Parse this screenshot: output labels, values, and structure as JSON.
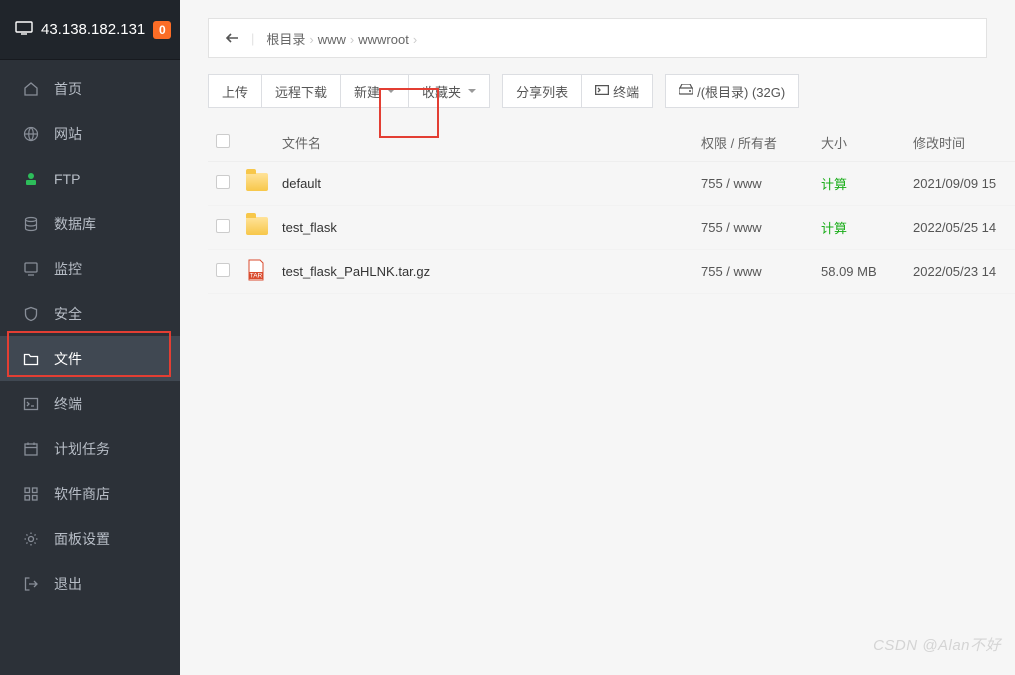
{
  "header": {
    "ip": "43.138.182.131",
    "badge": "0"
  },
  "sidebar": {
    "items": [
      {
        "label": "首页",
        "icon": "home-icon"
      },
      {
        "label": "网站",
        "icon": "globe-icon"
      },
      {
        "label": "FTP",
        "icon": "ftp-icon"
      },
      {
        "label": "数据库",
        "icon": "database-icon"
      },
      {
        "label": "监控",
        "icon": "monitor-icon"
      },
      {
        "label": "安全",
        "icon": "shield-icon"
      },
      {
        "label": "文件",
        "icon": "folder-icon"
      },
      {
        "label": "终端",
        "icon": "terminal-icon"
      },
      {
        "label": "计划任务",
        "icon": "calendar-icon"
      },
      {
        "label": "软件商店",
        "icon": "apps-icon"
      },
      {
        "label": "面板设置",
        "icon": "gear-icon"
      },
      {
        "label": "退出",
        "icon": "exit-icon"
      }
    ]
  },
  "breadcrumb": {
    "items": [
      "根目录",
      "www",
      "wwwroot"
    ]
  },
  "toolbar": {
    "upload": "上传",
    "remote_download": "远程下载",
    "create": "新建",
    "favorites": "收藏夹",
    "share_list": "分享列表",
    "terminal": "终端",
    "disk": "/(根目录) (32G)"
  },
  "columns": {
    "name": "文件名",
    "perm": "权限 / 所有者",
    "size": "大小",
    "mtime": "修改时间"
  },
  "files": [
    {
      "name": "default",
      "type": "folder",
      "perm": "755 / www",
      "size_label": "计算",
      "size_is_calc": true,
      "mtime": "2021/09/09 15"
    },
    {
      "name": "test_flask",
      "type": "folder",
      "perm": "755 / www",
      "size_label": "计算",
      "size_is_calc": true,
      "mtime": "2022/05/25 14"
    },
    {
      "name": "test_flask_PaHLNK.tar.gz",
      "type": "tar",
      "perm": "755 / www",
      "size_label": "58.09 MB",
      "size_is_calc": false,
      "mtime": "2022/05/23 14"
    }
  ],
  "watermark": "CSDN @Alan不好"
}
